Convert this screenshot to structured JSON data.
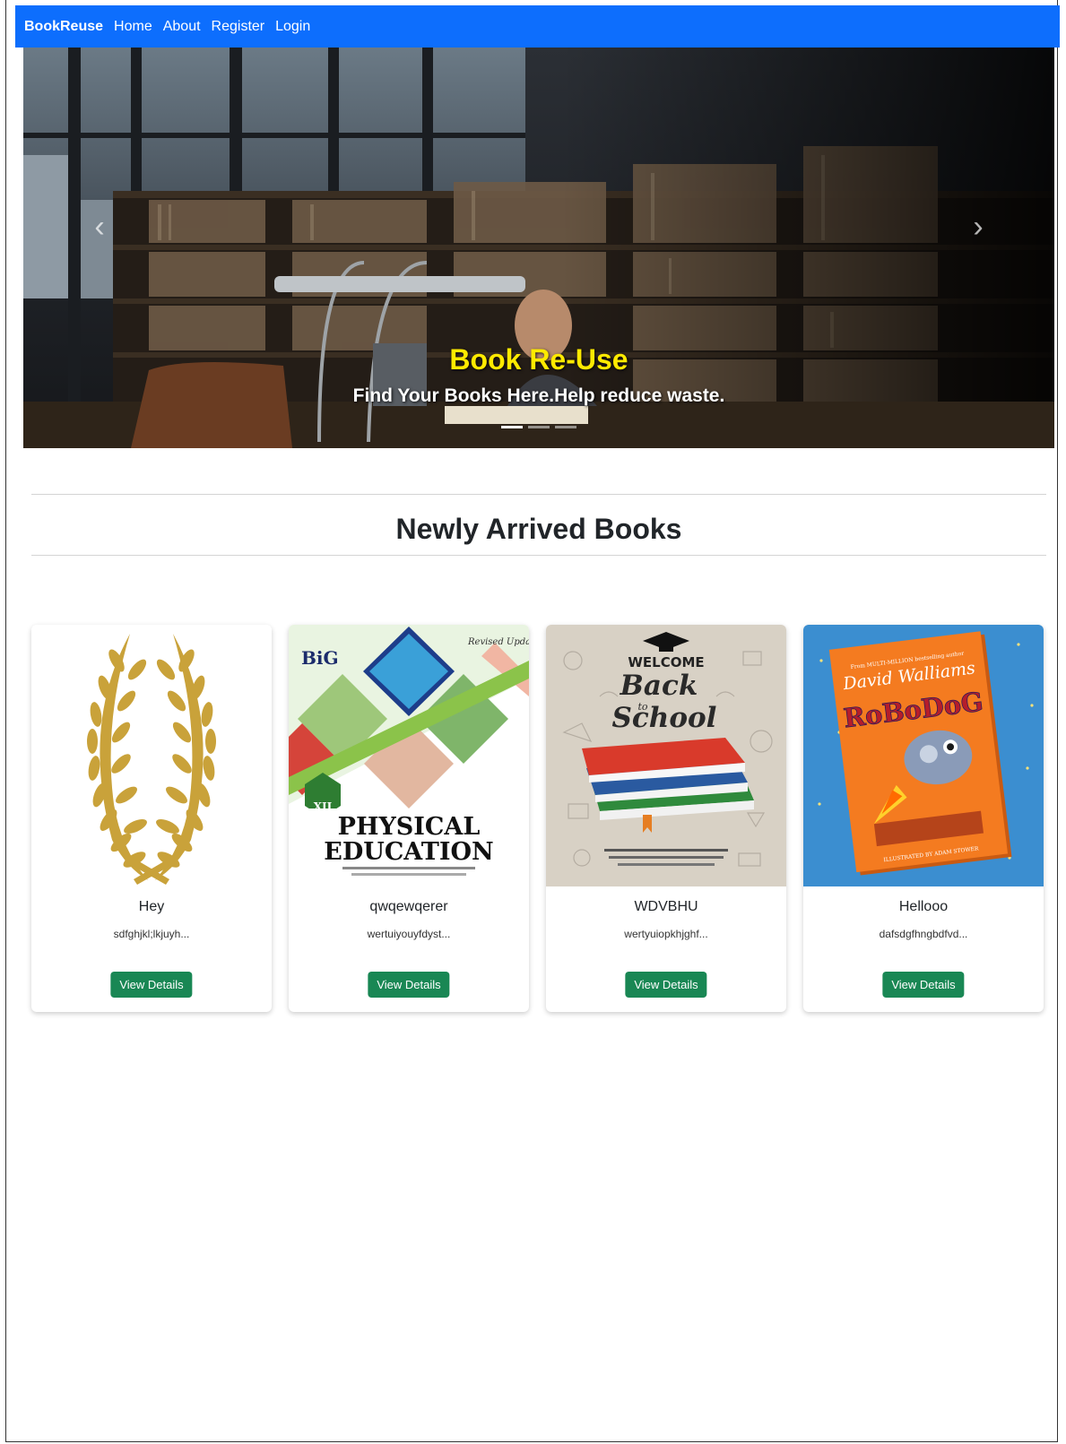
{
  "navbar": {
    "brand": "BookReuse",
    "links": [
      "Home",
      "About",
      "Register",
      "Login"
    ]
  },
  "hero": {
    "title": "Book Re-Use",
    "subtitle": "Find Your Books Here.Help reduce waste.",
    "prev_icon": "chevron-left-icon",
    "next_icon": "chevron-right-icon"
  },
  "section": {
    "title": "Newly Arrived Books"
  },
  "books": [
    {
      "title": "Hey",
      "description": "sdfghjkl;lkjuyh...",
      "button": "View Details"
    },
    {
      "title": "qwqewqerer",
      "description": "wertuiyouyfdyst...",
      "button": "View Details"
    },
    {
      "title": "WDVBHU",
      "description": "wertyuiopkhjghf...",
      "button": "View Details"
    },
    {
      "title": "Hellooo",
      "description": "dafsdgfhngbdfvd...",
      "button": "View Details"
    }
  ],
  "covers": {
    "c2_brand": "BiG",
    "c2_tag": "Revised Updated",
    "c2_class": "XII",
    "c2_title_1": "PHYSICAL",
    "c2_title_2": "EDUCATION",
    "c3_welcome": "WELCOME",
    "c3_back": "Back",
    "c3_to": "to",
    "c3_school": "School",
    "c4_author": "David Walliams",
    "c4_title": "RoBoDoG"
  },
  "colors": {
    "navbar": "#0d6efd",
    "button": "#198754",
    "hero_title": "#ffea00"
  }
}
